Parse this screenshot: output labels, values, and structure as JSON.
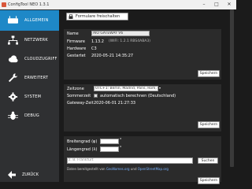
{
  "window": {
    "title": "ConfigTool NEO 1.3.1",
    "minimize": "–",
    "maximize": "□",
    "close": "✕"
  },
  "sidebar": {
    "items": [
      {
        "label": "ALLGEMEIN",
        "icon": "gateway-icon",
        "active": true
      },
      {
        "label": "NETZWERK",
        "icon": "network-icon",
        "active": false
      },
      {
        "label": "CLOUDZUGRIFF",
        "icon": "cloud-icon",
        "active": false
      },
      {
        "label": "ERWEITERT",
        "icon": "wrench-icon",
        "active": false
      },
      {
        "label": "SYSTEM",
        "icon": "gear-icon",
        "active": false
      },
      {
        "label": "DEBUG",
        "icon": "bug-icon",
        "active": false
      }
    ],
    "back_label": "ZURÜCK"
  },
  "main": {
    "release_button": "Formulare freischalten",
    "device": {
      "name_label": "Name",
      "name_value": "AIO GATEWAY V6",
      "firmware_label": "Firmware",
      "firmware_version": "1.13.2",
      "firmware_extra": "(WIFI: 1.2.1 RBS4ABA3)",
      "hardware_label": "Hardware",
      "hardware_value": "C3",
      "started_label": "Gestartet",
      "started_value": "2020-05-21 14:35:27",
      "save_label": "Speichern"
    },
    "time": {
      "timezone_label": "Zeitzone",
      "timezone_value": "UTC+1: Berlin, Madrid, Paris, Rom, Wien",
      "dst_label": "Sommerzeit",
      "dst_text": "automatisch berechnen (Deutschland)",
      "gwtime_label": "Gateway-Zeit",
      "gwtime_value": "2020-06-01 21:27:33",
      "save_label": "Speichern"
    },
    "geo": {
      "lat_label": "Breitengrad (φ)",
      "lon_label": "Längengrad (λ)",
      "degree": "°",
      "location_placeholder": "z. B. Frankfurt",
      "search_label": "Suchen",
      "source_prefix": "Daten bereitgestellt von ",
      "source_link1": "GeoNames.org",
      "source_mid": " und ",
      "source_link2": "OpenStreetMap.org",
      "save_label": "Speichern"
    }
  },
  "colors": {
    "accent": "#1e88c7",
    "sidebar_bg": "#2f3032",
    "main_bg": "#1b1b1b",
    "card_bg": "#2b2b2b"
  }
}
